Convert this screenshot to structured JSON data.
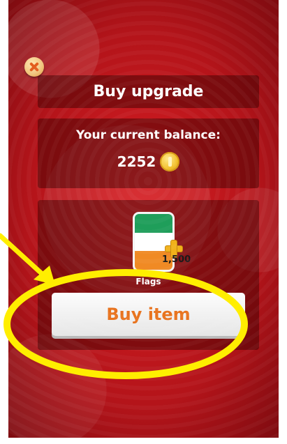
{
  "dialog": {
    "title": "Buy upgrade",
    "balance_label": "Your current balance:",
    "balance_value": "2252",
    "balance_icon": "coin-icon"
  },
  "item": {
    "name": "Flags",
    "price": "1,500",
    "icon": "flag-icon",
    "flag_colors": [
      "#1f9e5a",
      "#ffffff",
      "#f08a24"
    ]
  },
  "buy_button": {
    "label": "Buy item"
  },
  "close_button": {
    "icon": "close-icon"
  },
  "annotation": {
    "color": "#ffee00",
    "shapes": [
      "arrow",
      "ellipse-highlight"
    ]
  }
}
